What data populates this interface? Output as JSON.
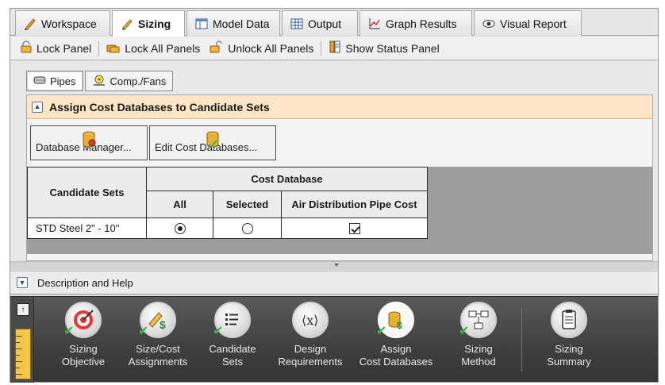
{
  "tabs": [
    {
      "label": "Workspace",
      "icon": "pencil-ruler-icon",
      "active": false
    },
    {
      "label": "Sizing",
      "icon": "pencil-icon",
      "active": true
    },
    {
      "label": "Model Data",
      "icon": "table-icon",
      "active": false
    },
    {
      "label": "Output",
      "icon": "grid-icon",
      "active": false
    },
    {
      "label": "Graph Results",
      "icon": "chart-icon",
      "active": false
    },
    {
      "label": "Visual Report",
      "icon": "eye-icon",
      "active": false
    }
  ],
  "toolbar": {
    "lock_panel": "Lock Panel",
    "lock_all_panels": "Lock All Panels",
    "unlock_all_panels": "Unlock All Panels",
    "show_status_panel": "Show Status Panel"
  },
  "subtabs": [
    {
      "label": "Pipes",
      "icon": "pipe-icon",
      "active": true
    },
    {
      "label": "Comp./Fans",
      "icon": "fan-icon",
      "active": false
    }
  ],
  "section": {
    "title": "Assign Cost Databases to Candidate Sets",
    "database_manager_button": "Database Manager...",
    "edit_cost_databases_button": "Edit Cost Databases..."
  },
  "grid": {
    "header_candidate_sets": "Candidate Sets",
    "header_cost_database": "Cost Database",
    "header_all": "All",
    "header_selected": "Selected",
    "header_air_distribution": "Air Distribution Pipe Cost",
    "rows": [
      {
        "name": "STD Steel 2\" - 10\"",
        "all_selected": true,
        "selected_selected": false,
        "air_distribution_checked": true
      }
    ]
  },
  "description_help": "Description and Help",
  "wizard_steps": [
    {
      "line1": "Sizing",
      "line2": "Objective",
      "icon": "target-icon",
      "done": true
    },
    {
      "line1": "Size/Cost",
      "line2": "Assignments",
      "icon": "ruler-dollar-icon",
      "done": true
    },
    {
      "line1": "Candidate",
      "line2": "Sets",
      "icon": "list-icon",
      "done": true
    },
    {
      "line1": "Design",
      "line2": "Requirements",
      "icon": "variable-x-icon",
      "done": false
    },
    {
      "line1": "Assign",
      "line2": "Cost Databases",
      "icon": "database-dollar-icon",
      "done": true
    },
    {
      "line1": "Sizing",
      "line2": "Method",
      "icon": "flowchart-icon",
      "done": true
    },
    {
      "line1": "Sizing",
      "line2": "Summary",
      "icon": "clipboard-icon",
      "done": false
    }
  ],
  "colors": {
    "section_header_bg": "#fde5c5",
    "wizard_bg": "#3f3f3f",
    "check_green": "#3bb54a"
  }
}
